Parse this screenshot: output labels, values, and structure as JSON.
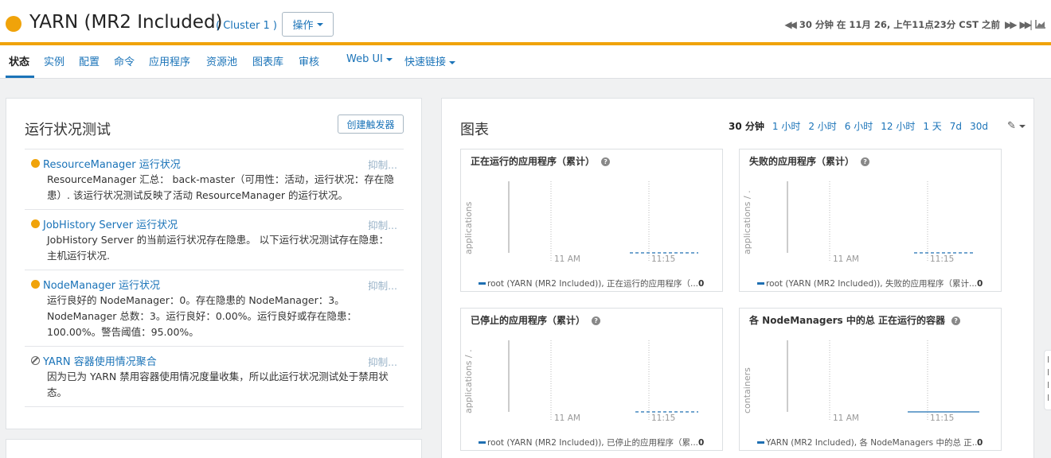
{
  "header": {
    "title": "YARN (MR2 Included)",
    "cluster": "( Cluster 1 )",
    "actions_label": "操作",
    "time_text": "30 分钟 在 11月 26, 上午11点23分 CST 之前",
    "status_color": "#f0a30a"
  },
  "nav": {
    "items": [
      {
        "label": "状态"
      },
      {
        "label": "实例"
      },
      {
        "label": "配置"
      },
      {
        "label": "命令"
      },
      {
        "label": "应用程序"
      },
      {
        "label": "资源池"
      },
      {
        "label": "图表库"
      },
      {
        "label": "审核"
      },
      {
        "label": "Web UI"
      },
      {
        "label": "快速链接"
      }
    ]
  },
  "health": {
    "title": "运行状况测试",
    "create_trigger": "创建触发器",
    "suppress_label": "抑制...",
    "items": [
      {
        "name": "ResourceManager 运行状况",
        "status": "warning",
        "text": "ResourceManager 汇总： back-master（可用性：活动，运行状况：存在隐患）. 该运行状况测试反映了活动 ResourceManager 的运行状况。"
      },
      {
        "name": "JobHistory Server 运行状况",
        "status": "warning",
        "text": "JobHistory Server 的当前运行状况存在隐患。 以下运行状况测试存在隐患：主机运行状况."
      },
      {
        "name": "NodeManager 运行状况",
        "status": "warning",
        "text": "运行良好的 NodeManager：0。存在隐患的 NodeManager：3。NodeManager 总数：3。运行良好：0.00%。运行良好或存在隐患：100.00%。警告阈值：95.00%。"
      },
      {
        "name": "YARN 容器使用情况聚合",
        "status": "disabled",
        "text": "因为已为 YARN 禁用容器使用情况度量收集，所以此运行状况测试处于禁用状态。"
      }
    ]
  },
  "charts_panel": {
    "title": "图表",
    "ranges": [
      "30 分钟",
      "1 小时",
      "2 小时",
      "6 小时",
      "12 小时",
      "1 天",
      "7d",
      "30d"
    ],
    "selected_range": "30 分钟"
  },
  "chart_data": [
    {
      "type": "line",
      "title": "正在运行的应用程序（累计）",
      "ylabel": "applications",
      "x_ticks": [
        "11 AM",
        "11:15"
      ],
      "series": [
        {
          "name": "root (YARN (MR2 Included)), 正在运行的应用程序（...",
          "last_value": "0"
        }
      ],
      "series_color": "#1f6fb2",
      "line": "dashed"
    },
    {
      "type": "line",
      "title": "失败的应用程序（累计）",
      "ylabel": "applications / ...",
      "x_ticks": [
        "11 AM",
        "11:15"
      ],
      "series": [
        {
          "name": "root (YARN (MR2 Included)), 失败的应用程序（累计...",
          "last_value": "0"
        }
      ],
      "series_color": "#1f6fb2",
      "line": "dashed"
    },
    {
      "type": "line",
      "title": "已停止的应用程序（累计）",
      "ylabel": "applications / ...",
      "x_ticks": [
        "11 AM",
        "11:15"
      ],
      "series": [
        {
          "name": "root (YARN (MR2 Included)), 已停止的应用程序（累...",
          "last_value": "0"
        }
      ],
      "series_color": "#1f6fb2",
      "line": "dashed"
    },
    {
      "type": "line",
      "title": "各 NodeManagers 中的总 正在运行的容器",
      "ylabel": "containers",
      "x_ticks": [
        "11 AM",
        "11:15"
      ],
      "series": [
        {
          "name": "YARN (MR2 Included), 各 NodeManagers 中的总 正...",
          "last_value": "0"
        }
      ],
      "series_color": "#1f6fb2",
      "line": "solid"
    }
  ]
}
